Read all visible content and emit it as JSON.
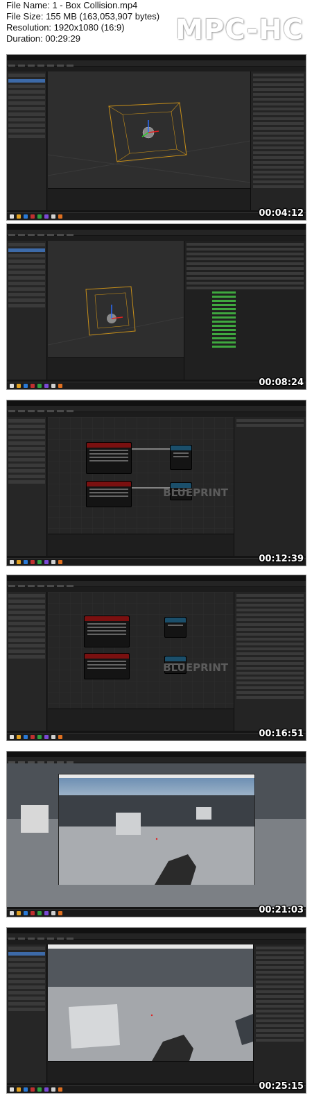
{
  "info": {
    "file_name": "File Name: 1 - Box Collision.mp4",
    "file_size": "File Size: 155 MB (163,053,907 bytes)",
    "resolution": "Resolution: 1920x1080 (16:9)",
    "duration": "Duration: 00:29:29"
  },
  "logo": "MPC-HC",
  "frames": [
    {
      "timestamp": "00:04:12",
      "scene": "3d-viewport"
    },
    {
      "timestamp": "00:08:24",
      "scene": "3d-viewport-collision"
    },
    {
      "timestamp": "00:12:39",
      "scene": "blueprint"
    },
    {
      "timestamp": "00:16:51",
      "scene": "blueprint-details"
    },
    {
      "timestamp": "00:21:03",
      "scene": "game-play"
    },
    {
      "timestamp": "00:25:15",
      "scene": "game-play-editor"
    }
  ],
  "blueprint_watermark": "BLUEPRINT",
  "colors": {
    "accent_selection": "#3d6aa8",
    "collision_box": "#c8901a",
    "node_event_header": "#7a1010",
    "node_function_header": "#1b4f6b",
    "collision_enabled": "#3fa83f"
  }
}
